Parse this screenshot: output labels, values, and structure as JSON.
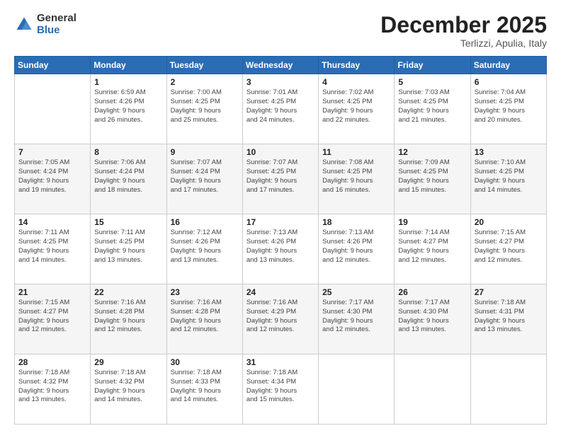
{
  "logo": {
    "general": "General",
    "blue": "Blue"
  },
  "title": {
    "month": "December 2025",
    "location": "Terlizzi, Apulia, Italy"
  },
  "weekdays": [
    "Sunday",
    "Monday",
    "Tuesday",
    "Wednesday",
    "Thursday",
    "Friday",
    "Saturday"
  ],
  "weeks": [
    [
      {
        "day": "",
        "info": ""
      },
      {
        "day": "1",
        "info": "Sunrise: 6:59 AM\nSunset: 4:26 PM\nDaylight: 9 hours\nand 26 minutes."
      },
      {
        "day": "2",
        "info": "Sunrise: 7:00 AM\nSunset: 4:25 PM\nDaylight: 9 hours\nand 25 minutes."
      },
      {
        "day": "3",
        "info": "Sunrise: 7:01 AM\nSunset: 4:25 PM\nDaylight: 9 hours\nand 24 minutes."
      },
      {
        "day": "4",
        "info": "Sunrise: 7:02 AM\nSunset: 4:25 PM\nDaylight: 9 hours\nand 22 minutes."
      },
      {
        "day": "5",
        "info": "Sunrise: 7:03 AM\nSunset: 4:25 PM\nDaylight: 9 hours\nand 21 minutes."
      },
      {
        "day": "6",
        "info": "Sunrise: 7:04 AM\nSunset: 4:25 PM\nDaylight: 9 hours\nand 20 minutes."
      }
    ],
    [
      {
        "day": "7",
        "info": "Sunrise: 7:05 AM\nSunset: 4:24 PM\nDaylight: 9 hours\nand 19 minutes."
      },
      {
        "day": "8",
        "info": "Sunrise: 7:06 AM\nSunset: 4:24 PM\nDaylight: 9 hours\nand 18 minutes."
      },
      {
        "day": "9",
        "info": "Sunrise: 7:07 AM\nSunset: 4:24 PM\nDaylight: 9 hours\nand 17 minutes."
      },
      {
        "day": "10",
        "info": "Sunrise: 7:07 AM\nSunset: 4:25 PM\nDaylight: 9 hours\nand 17 minutes."
      },
      {
        "day": "11",
        "info": "Sunrise: 7:08 AM\nSunset: 4:25 PM\nDaylight: 9 hours\nand 16 minutes."
      },
      {
        "day": "12",
        "info": "Sunrise: 7:09 AM\nSunset: 4:25 PM\nDaylight: 9 hours\nand 15 minutes."
      },
      {
        "day": "13",
        "info": "Sunrise: 7:10 AM\nSunset: 4:25 PM\nDaylight: 9 hours\nand 14 minutes."
      }
    ],
    [
      {
        "day": "14",
        "info": "Sunrise: 7:11 AM\nSunset: 4:25 PM\nDaylight: 9 hours\nand 14 minutes."
      },
      {
        "day": "15",
        "info": "Sunrise: 7:11 AM\nSunset: 4:25 PM\nDaylight: 9 hours\nand 13 minutes."
      },
      {
        "day": "16",
        "info": "Sunrise: 7:12 AM\nSunset: 4:26 PM\nDaylight: 9 hours\nand 13 minutes."
      },
      {
        "day": "17",
        "info": "Sunrise: 7:13 AM\nSunset: 4:26 PM\nDaylight: 9 hours\nand 13 minutes."
      },
      {
        "day": "18",
        "info": "Sunrise: 7:13 AM\nSunset: 4:26 PM\nDaylight: 9 hours\nand 12 minutes."
      },
      {
        "day": "19",
        "info": "Sunrise: 7:14 AM\nSunset: 4:27 PM\nDaylight: 9 hours\nand 12 minutes."
      },
      {
        "day": "20",
        "info": "Sunrise: 7:15 AM\nSunset: 4:27 PM\nDaylight: 9 hours\nand 12 minutes."
      }
    ],
    [
      {
        "day": "21",
        "info": "Sunrise: 7:15 AM\nSunset: 4:27 PM\nDaylight: 9 hours\nand 12 minutes."
      },
      {
        "day": "22",
        "info": "Sunrise: 7:16 AM\nSunset: 4:28 PM\nDaylight: 9 hours\nand 12 minutes."
      },
      {
        "day": "23",
        "info": "Sunrise: 7:16 AM\nSunset: 4:28 PM\nDaylight: 9 hours\nand 12 minutes."
      },
      {
        "day": "24",
        "info": "Sunrise: 7:16 AM\nSunset: 4:29 PM\nDaylight: 9 hours\nand 12 minutes."
      },
      {
        "day": "25",
        "info": "Sunrise: 7:17 AM\nSunset: 4:30 PM\nDaylight: 9 hours\nand 12 minutes."
      },
      {
        "day": "26",
        "info": "Sunrise: 7:17 AM\nSunset: 4:30 PM\nDaylight: 9 hours\nand 13 minutes."
      },
      {
        "day": "27",
        "info": "Sunrise: 7:18 AM\nSunset: 4:31 PM\nDaylight: 9 hours\nand 13 minutes."
      }
    ],
    [
      {
        "day": "28",
        "info": "Sunrise: 7:18 AM\nSunset: 4:32 PM\nDaylight: 9 hours\nand 13 minutes."
      },
      {
        "day": "29",
        "info": "Sunrise: 7:18 AM\nSunset: 4:32 PM\nDaylight: 9 hours\nand 14 minutes."
      },
      {
        "day": "30",
        "info": "Sunrise: 7:18 AM\nSunset: 4:33 PM\nDaylight: 9 hours\nand 14 minutes."
      },
      {
        "day": "31",
        "info": "Sunrise: 7:18 AM\nSunset: 4:34 PM\nDaylight: 9 hours\nand 15 minutes."
      },
      {
        "day": "",
        "info": ""
      },
      {
        "day": "",
        "info": ""
      },
      {
        "day": "",
        "info": ""
      }
    ]
  ]
}
